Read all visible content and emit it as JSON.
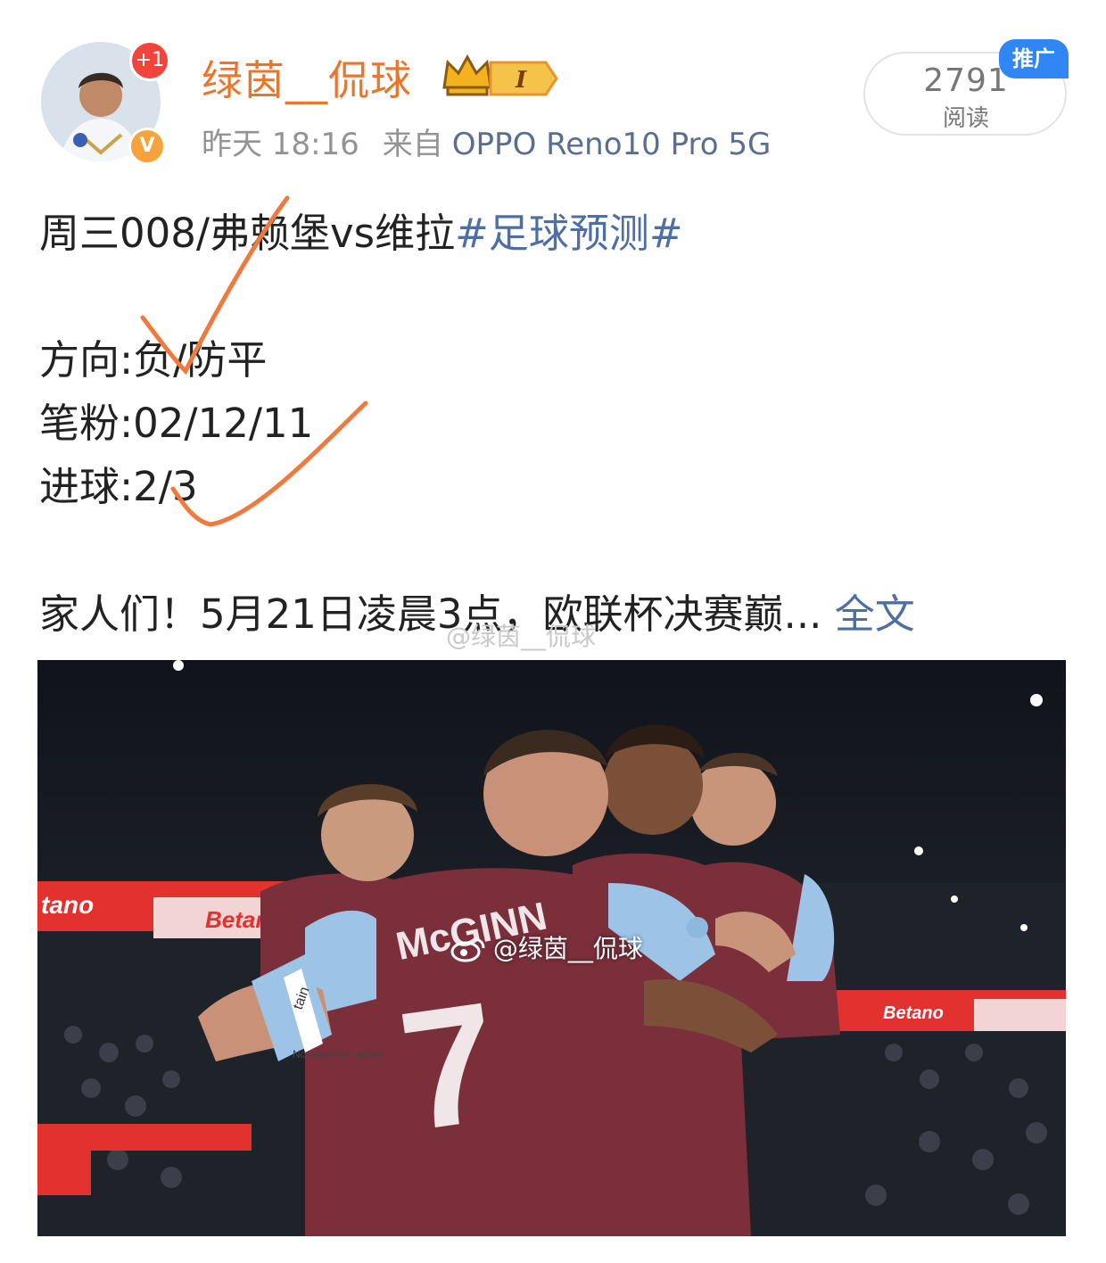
{
  "post": {
    "author": {
      "name": "绿茵__侃球",
      "avatar_badge": "+1",
      "verified_mark": "V",
      "level_badge": "I"
    },
    "time": "昨天 18:16",
    "from_label": "来自",
    "device": "OPPO Reno10 Pro 5G",
    "reads": {
      "count": "2791",
      "label": "阅读"
    },
    "promo_tag": "推广",
    "lines": {
      "line1_text": "周三008/弗赖堡vs维拉",
      "line1_hashtag": "#足球预测#",
      "line2": "方向:负/防平",
      "line3": "笔粉:02/12/11",
      "line4": "进球:2/3",
      "line5_text": "家人们！5月21日凌晨3点，欧联杯决赛巅...",
      "line5_more": "全文"
    },
    "text_watermark": "@绿茵__侃球",
    "image": {
      "watermark": "@绿茵__侃球",
      "board_left": "tano",
      "board_mid": "Betano",
      "board_right": "Betano",
      "jersey_name": "McGINN",
      "jersey_number": "7",
      "captain_text": "tain",
      "sleeve_text": "No room for racism"
    }
  },
  "colors": {
    "username": "#e8772e",
    "link": "#4d6fa4",
    "ink": "#f07a3e",
    "promo": "#2f86f4",
    "claret": "#7a2f3b",
    "sky": "#9dc3e6"
  },
  "icons": [
    "crown-icon",
    "verified-icon",
    "weibo-logo-icon"
  ]
}
